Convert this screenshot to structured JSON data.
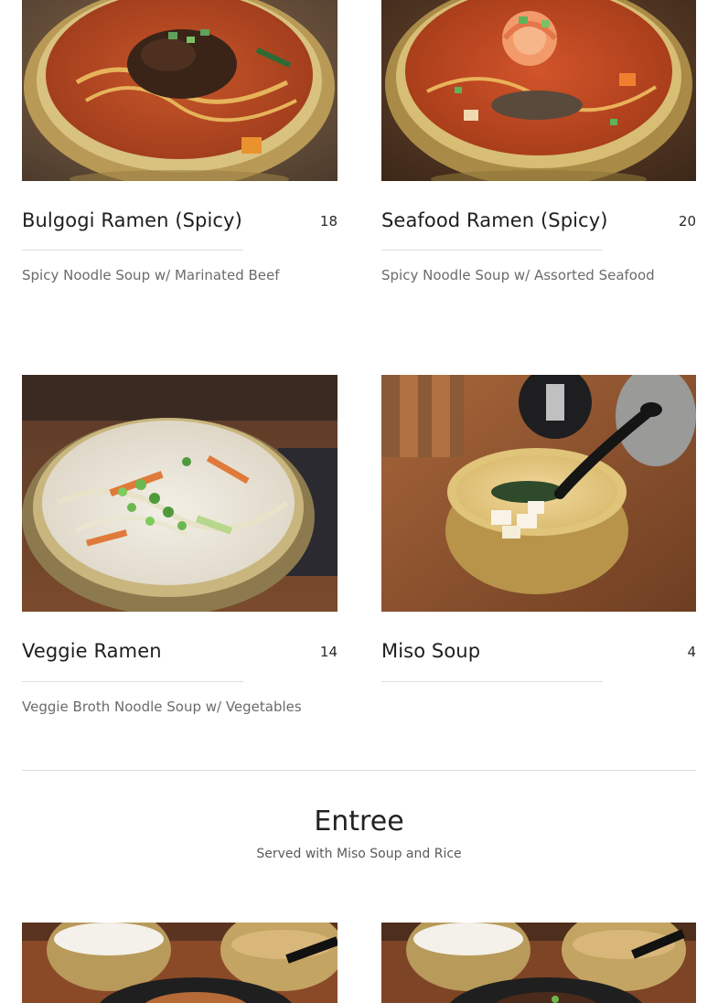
{
  "ramen": {
    "items": [
      {
        "name": "Bulgogi Ramen (Spicy)",
        "price": "18",
        "description": "Spicy Noodle Soup w/ Marinated Beef",
        "image_alt": "Bulgogi ramen in brass bowl"
      },
      {
        "name": "Seafood Ramen (Spicy)",
        "price": "20",
        "description": "Spicy Noodle Soup w/ Assorted Seafood",
        "image_alt": "Seafood ramen with shrimp in brass bowl"
      },
      {
        "name": "Veggie Ramen",
        "price": "14",
        "description": "Veggie Broth Noodle Soup w/ Vegetables",
        "image_alt": "Veggie ramen in creamy broth"
      },
      {
        "name": "Miso Soup",
        "price": "4",
        "description": "",
        "image_alt": "Miso soup in brass bowl with black spoon"
      }
    ]
  },
  "entree": {
    "title": "Entree",
    "subtitle": "Served with Miso Soup and Rice",
    "items": [
      {
        "image_alt": "Entree plate with rice and sauce"
      },
      {
        "image_alt": "Entree plate with rice and sauce"
      }
    ]
  }
}
